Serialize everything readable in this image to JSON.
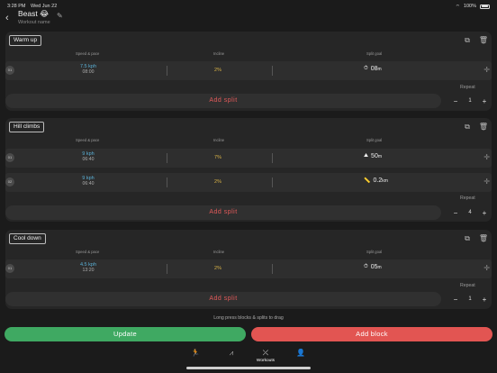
{
  "status": {
    "time": "3:28 PM",
    "date": "Wed Jun 22",
    "battery": "100%"
  },
  "header": {
    "title": "Beast 😂",
    "subtitle": "Workout name"
  },
  "column_headers": {
    "speed": "Speed & pace",
    "incline": "Incline",
    "goal": "Split goal"
  },
  "blocks": [
    {
      "name": "Warm up",
      "splits": [
        {
          "idx": "01",
          "kph": "7.5",
          "unit": "kph",
          "pace": "08:00",
          "incline": "2%",
          "goal_icon": "timer-icon",
          "goal": "08",
          "goal_unit": "m"
        }
      ],
      "add_split": "Add split",
      "repeat_label": "Repeat",
      "repeat": "1"
    },
    {
      "name": "Hill climbs",
      "splits": [
        {
          "idx": "01",
          "kph": "9",
          "unit": "kph",
          "pace": "06:40",
          "incline": "7%",
          "goal_icon": "elevation-icon",
          "goal": "50",
          "goal_unit": "m"
        },
        {
          "idx": "02",
          "kph": "9",
          "unit": "kph",
          "pace": "06:40",
          "incline": "2%",
          "goal_icon": "ruler-icon",
          "goal": "0.2",
          "goal_unit": "km"
        }
      ],
      "add_split": "Add split",
      "repeat_label": "Repeat",
      "repeat": "4"
    },
    {
      "name": "Cool down",
      "splits": [
        {
          "idx": "01",
          "kph": "4.5",
          "unit": "kph",
          "pace": "13:20",
          "incline": "2%",
          "goal_icon": "timer-icon",
          "goal": "05",
          "goal_unit": "m"
        }
      ],
      "add_split": "Add split",
      "repeat_label": "Repeat",
      "repeat": "1"
    }
  ],
  "hint": "Long press blocks & splits to drag",
  "buttons": {
    "update": "Update",
    "add_block": "Add block"
  },
  "tabs": [
    {
      "icon": "run-icon",
      "label": ""
    },
    {
      "icon": "stats-icon",
      "label": ""
    },
    {
      "icon": "workouts-icon",
      "label": "Workouts"
    },
    {
      "icon": "profile-settings-icon",
      "label": ""
    }
  ],
  "colors": {
    "accent_blue": "#5ab0d6",
    "incline_yellow": "#d9b347",
    "green": "#3fa962",
    "red": "#e25552"
  }
}
